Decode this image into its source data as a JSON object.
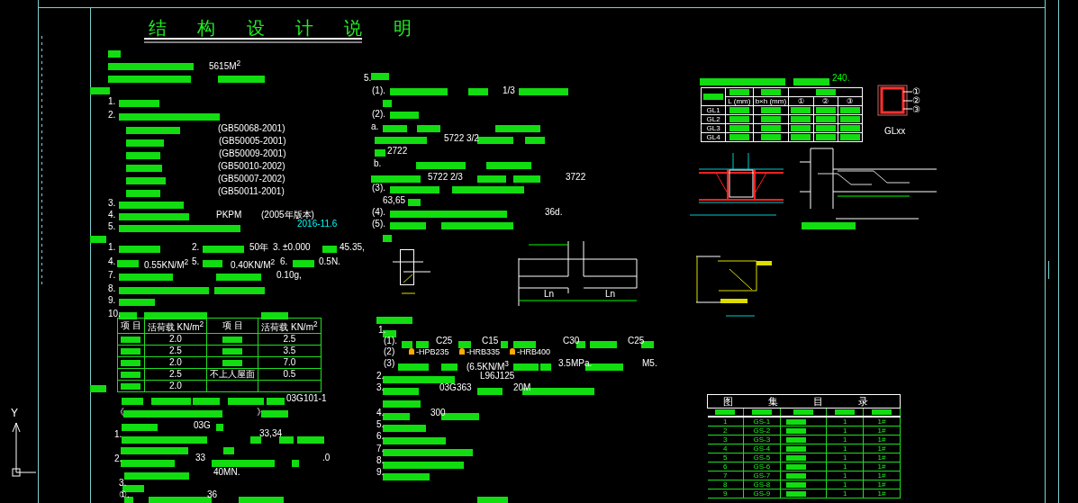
{
  "title": "结 构 设 计 说 明",
  "notes_left": [
    {
      "text": "5615M$^{2}$",
      "kind": "value"
    },
    {
      "text": "1.",
      "kind": "value"
    },
    {
      "text": "2.",
      "kind": "value"
    },
    {
      "text": "(GB50068-2001)",
      "kind": "value"
    },
    {
      "text": "(GB50005-2001)",
      "kind": "value"
    },
    {
      "text": "(GB50009-2001)",
      "kind": "value"
    },
    {
      "text": "(GB50010-2002)",
      "kind": "value"
    },
    {
      "text": "(GB50007-2002)",
      "kind": "value"
    },
    {
      "text": "(GB50011-2001)",
      "kind": "value"
    },
    {
      "text": "3.",
      "kind": "value"
    },
    {
      "text": "4.",
      "kind": "value"
    },
    {
      "text": "PKPM",
      "kind": "value"
    },
    {
      "text": "(2005年版本)",
      "kind": "value"
    },
    {
      "text": "5.",
      "kind": "value"
    },
    {
      "text": "2016-11.6",
      "kind": "date"
    },
    {
      "text": "1.",
      "kind": "value"
    },
    {
      "text": "2.",
      "kind": "value"
    },
    {
      "text": "50年",
      "kind": "value"
    },
    {
      "text": "3. ±0.000",
      "kind": "value"
    },
    {
      "text": "45.35,",
      "kind": "value"
    },
    {
      "text": "4.",
      "kind": "value"
    },
    {
      "text": "0.55KN/M$^{2}$",
      "kind": "value"
    },
    {
      "text": "5.",
      "kind": "value"
    },
    {
      "text": "0.40KN/M$^{2}$",
      "kind": "value"
    },
    {
      "text": "6.",
      "kind": "value"
    },
    {
      "text": "0.5N.",
      "kind": "value"
    },
    {
      "text": "7.",
      "kind": "value"
    },
    {
      "text": "0.10g,",
      "kind": "value"
    },
    {
      "text": "8.",
      "kind": "value"
    },
    {
      "text": "9.",
      "kind": "value"
    },
    {
      "text": "10.",
      "kind": "value"
    },
    {
      "text": "03G101-1",
      "kind": "value"
    },
    {
      "text": "《",
      "kind": "value"
    },
    {
      "text": "》",
      "kind": "value"
    },
    {
      "text": "03G",
      "kind": "value"
    },
    {
      "text": "1.",
      "kind": "value"
    },
    {
      "text": "33,34",
      "kind": "value"
    },
    {
      "text": "2.",
      "kind": "value"
    },
    {
      "text": "33",
      "kind": "value"
    },
    {
      "text": ".0",
      "kind": "value"
    },
    {
      "text": "40MN.",
      "kind": "value"
    },
    {
      "text": "3.",
      "kind": "value"
    },
    {
      "text": "①.",
      "kind": "value"
    },
    {
      "text": "36",
      "kind": "value"
    }
  ],
  "notes_middle": [
    {
      "text": "5.",
      "kind": "value"
    },
    {
      "text": "(1).",
      "kind": "value"
    },
    {
      "text": "1/3",
      "kind": "value"
    },
    {
      "text": "(2).",
      "kind": "value"
    },
    {
      "text": "a.",
      "kind": "value"
    },
    {
      "text": "5722 3/2",
      "kind": "value"
    },
    {
      "text": "2722",
      "kind": "value"
    },
    {
      "text": "b.",
      "kind": "value"
    },
    {
      "text": "5722 2/3",
      "kind": "value"
    },
    {
      "text": "3722",
      "kind": "value"
    },
    {
      "text": "(3).",
      "kind": "value"
    },
    {
      "text": "63,65",
      "kind": "value"
    },
    {
      "text": "(4).",
      "kind": "value"
    },
    {
      "text": "36d.",
      "kind": "value"
    },
    {
      "text": "(5).",
      "kind": "value"
    },
    {
      "text": "1.",
      "kind": "value"
    },
    {
      "text": "(1).",
      "kind": "value"
    },
    {
      "text": "C25",
      "kind": "value"
    },
    {
      "text": "C15",
      "kind": "value"
    },
    {
      "text": "C30",
      "kind": "value"
    },
    {
      "text": "C25",
      "kind": "value"
    },
    {
      "text": "(2)",
      "kind": "value"
    },
    {
      "text": "-HPB235",
      "kind": "rebar"
    },
    {
      "text": "-HRB335",
      "kind": "rebar"
    },
    {
      "text": "-HRB400",
      "kind": "rebar"
    },
    {
      "text": "(3)",
      "kind": "value"
    },
    {
      "text": "(6.5KN/M$^{3}$",
      "kind": "value"
    },
    {
      "text": "3.5MPa.",
      "kind": "value"
    },
    {
      "text": "M5.",
      "kind": "value"
    },
    {
      "text": "2.",
      "kind": "value"
    },
    {
      "text": "L96J125",
      "kind": "value"
    },
    {
      "text": "3.",
      "kind": "value"
    },
    {
      "text": "03G363",
      "kind": "value"
    },
    {
      "text": "20M",
      "kind": "value"
    },
    {
      "text": "4.",
      "kind": "value"
    },
    {
      "text": "300",
      "kind": "value"
    },
    {
      "text": "5.",
      "kind": "value"
    },
    {
      "text": "6.",
      "kind": "value"
    },
    {
      "text": "7.",
      "kind": "value"
    },
    {
      "text": "8.",
      "kind": "value"
    },
    {
      "text": "9.",
      "kind": "value"
    }
  ],
  "beam_labels": [
    "Ln",
    "Ln"
  ],
  "load_table": {
    "columns": [
      "项 目",
      "活荷载 KN/m$^{2}$",
      "项 目",
      "活荷载 KN/m$^{2}$"
    ],
    "rows": [
      {
        "value": "2.0",
        "value_2": "2.5"
      },
      {
        "value": "2.5",
        "value_2": "3.5"
      },
      {
        "value": "2.0",
        "value_2": "7.0"
      },
      {
        "value": "2.5",
        "label_2": "不上人屋面",
        "value_2": "0.5"
      },
      {
        "value": "2.0"
      }
    ]
  },
  "lintel_table": {
    "note": "240.",
    "columns": [
      "L (mm)",
      "b×h (mm)",
      "①",
      "②",
      "③"
    ],
    "rows": [
      "GL1",
      "GL2",
      "GL3",
      "GL4"
    ]
  },
  "column_detail": {
    "label": "GLxx",
    "markers": [
      "①",
      "②",
      "③"
    ]
  },
  "drawing_index": {
    "title": "图 集 目 录",
    "rows": [
      {
        "number": "1",
        "code": "GS-1",
        "count": "1",
        "size": "1#"
      },
      {
        "number": "2",
        "code": "GS-2",
        "count": "1",
        "size": "1#"
      },
      {
        "number": "3",
        "code": "GS-3",
        "count": "1",
        "size": "1#"
      },
      {
        "number": "4",
        "code": "GS-4",
        "count": "1",
        "size": "1#"
      },
      {
        "number": "5",
        "code": "GS-5",
        "count": "1",
        "size": "1#"
      },
      {
        "number": "6",
        "code": "GS-6",
        "count": "1",
        "size": "1#"
      },
      {
        "number": "7",
        "code": "GS-7",
        "count": "1",
        "size": "1#"
      },
      {
        "number": "8",
        "code": "GS-8",
        "count": "1",
        "size": "1#"
      },
      {
        "number": "9",
        "code": "GS-9",
        "count": "1",
        "size": "1#"
      }
    ]
  },
  "axis_label": "Y"
}
